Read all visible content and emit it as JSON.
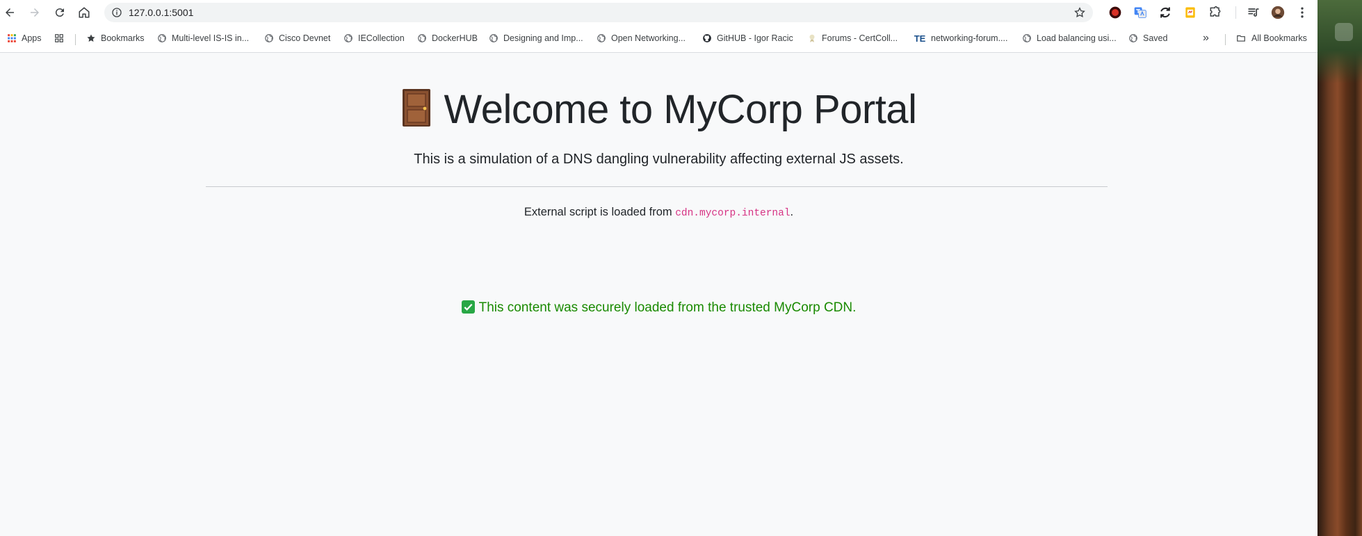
{
  "browser": {
    "url": "127.0.0.1:5001",
    "bookmarks": [
      {
        "label": "Apps",
        "icon": "apps-grid-icon"
      },
      {
        "label": "",
        "icon": "tab-groups-icon"
      },
      {
        "label": "Bookmarks",
        "icon": "star-icon"
      },
      {
        "label": "Multi-level IS-IS in...",
        "icon": "globe-icon"
      },
      {
        "label": "Cisco Devnet",
        "icon": "globe-icon"
      },
      {
        "label": "IECollection",
        "icon": "globe-icon"
      },
      {
        "label": "DockerHUB",
        "icon": "globe-icon"
      },
      {
        "label": "Designing and Imp...",
        "icon": "globe-icon"
      },
      {
        "label": "Open Networking...",
        "icon": "globe-icon"
      },
      {
        "label": "GitHUB - Igor Racic",
        "icon": "github-icon"
      },
      {
        "label": "Forums - CertColl...",
        "icon": "certcoll-icon"
      },
      {
        "label": "networking-forum....",
        "icon": "te-icon"
      },
      {
        "label": "Load balancing usi...",
        "icon": "globe-icon"
      },
      {
        "label": "Saved",
        "icon": "globe-icon"
      }
    ],
    "more_bookmarks": "»",
    "all_bookmarks": "All Bookmarks",
    "te_badge": "TE"
  },
  "page": {
    "title": "Welcome to MyCorp Portal",
    "lead": "This is a simulation of a DNS dangling vulnerability affecting external JS assets.",
    "external_prefix": "External script is loaded from ",
    "external_host": "cdn.mycorp.internal",
    "external_suffix": ".",
    "status_message": "This content was securely loaded from the trusted MyCorp CDN."
  },
  "colors": {
    "status_green": "#198a00",
    "code_pink": "#d63384",
    "page_bg": "#f8f9fa"
  }
}
